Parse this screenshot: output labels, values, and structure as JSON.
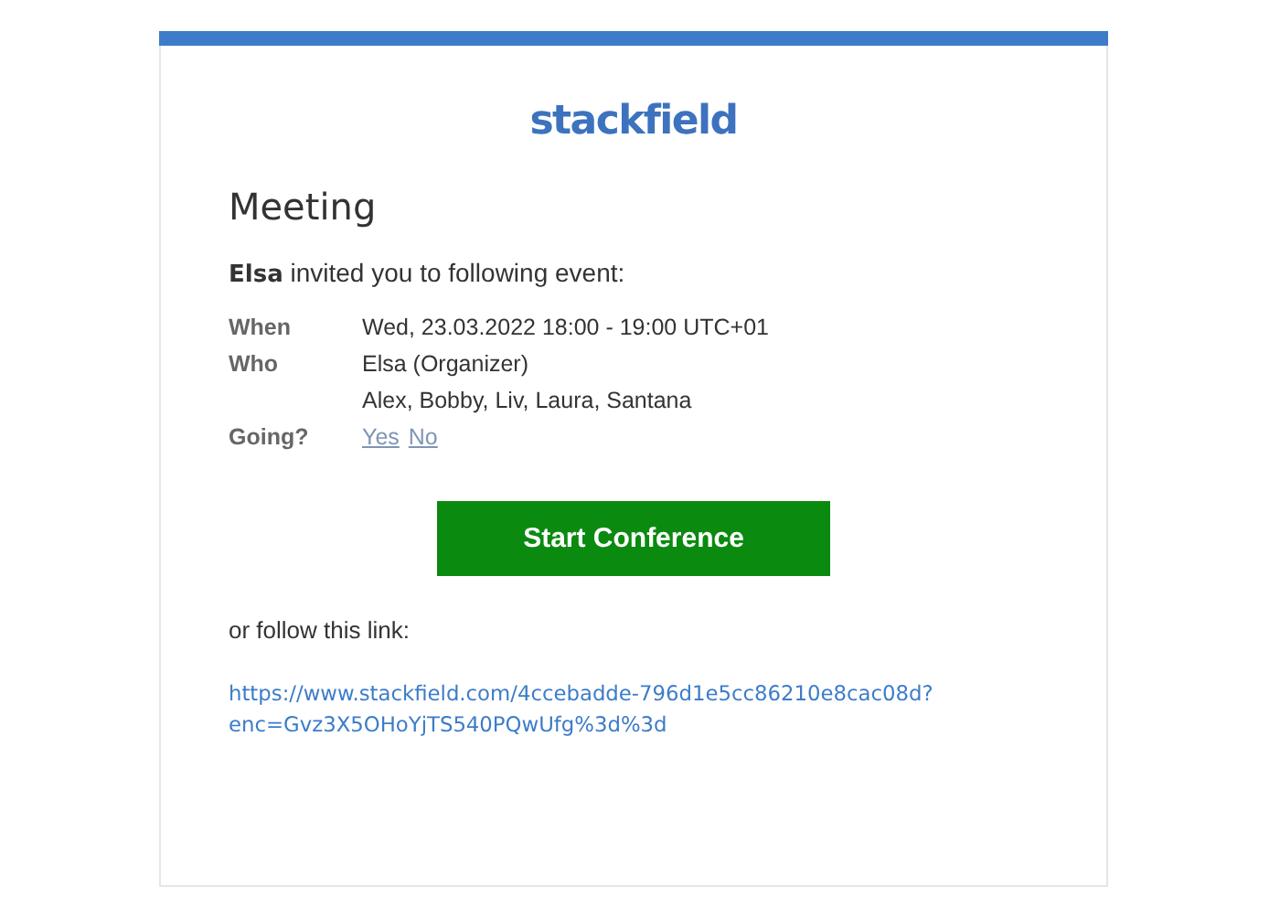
{
  "logo": "stackfield",
  "title": "Meeting",
  "intro": "**Elsa** invited you to following event:",
  "details": [
    {
      "label": "When",
      "kind": "text",
      "values": [
        "Wed, 23.03.2022 18:00 - 19:00 UTC+01"
      ]
    },
    {
      "label": "Who",
      "kind": "text",
      "values": [
        "Elsa (Organizer)",
        "Alex, Bobby, Liv, Laura, Santana"
      ]
    },
    {
      "label": "Going?",
      "kind": "links",
      "values": [
        "Yes",
        "No"
      ]
    }
  ],
  "button": "Start Conference",
  "follow_text": "or follow this link:",
  "link": "https://www.stackfield.com/4ccebadde-796d1e5cc86210e8cac08d?enc=Gvz3X5OHoYjTS540PQwUfg%3d%3d"
}
